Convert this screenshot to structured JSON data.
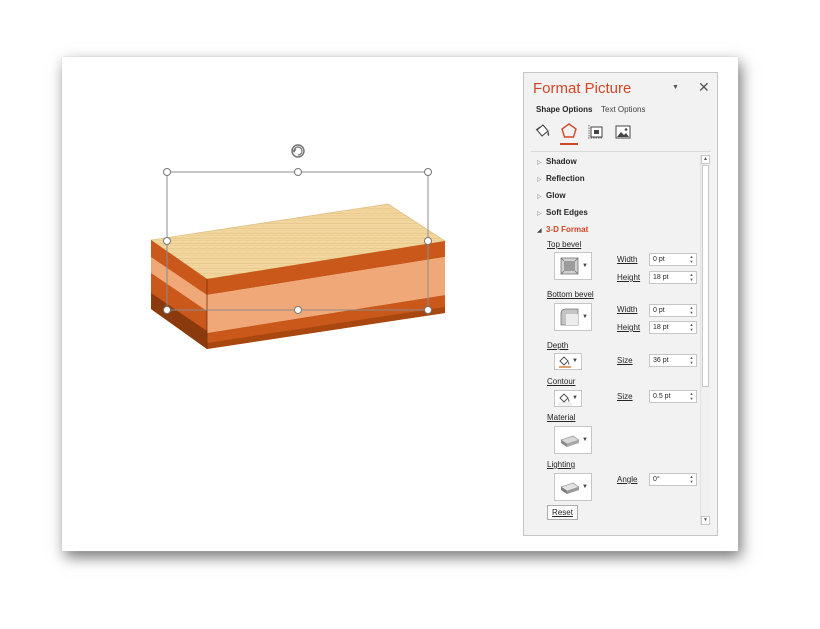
{
  "pane": {
    "title": "Format Picture",
    "pin_icon": "dropdown-triangle-icon",
    "close_icon": "close-icon",
    "close_glyph": "✕",
    "tabs": {
      "shape": "Shape Options",
      "text": "Text Options"
    },
    "icons": [
      "fill-line-icon",
      "effects-pentagon-icon",
      "size-properties-icon",
      "picture-icon"
    ],
    "sections": {
      "shadow": "Shadow",
      "reflection": "Reflection",
      "glow": "Glow",
      "soft_edges": "Soft Edges",
      "three_d": "3-D Format"
    },
    "three_d": {
      "top_bevel": {
        "label": "Top bevel",
        "width_label": "Width",
        "width": "0 pt",
        "height_label": "Height",
        "height": "18 pt"
      },
      "bottom_bevel": {
        "label": "Bottom bevel",
        "width_label": "Width",
        "width": "0 pt",
        "height_label": "Height",
        "height": "18 pt"
      },
      "depth": {
        "label": "Depth",
        "size_label": "Size",
        "size": "36 pt"
      },
      "contour": {
        "label": "Contour",
        "size_label": "Size",
        "size": "0.5 pt"
      },
      "material": {
        "label": "Material"
      },
      "lighting": {
        "label": "Lighting",
        "angle_label": "Angle",
        "angle": "0°"
      },
      "reset": "Reset"
    }
  },
  "colors": {
    "accent": "#d24726",
    "block_orange": "#c9581a",
    "block_dark": "#8a3a0d",
    "block_light": "#f0a878",
    "wood_top": "#f3d79e",
    "selection": "#8c8c8c"
  },
  "canvas": {
    "object": "3d-wood-block",
    "rotate_handle_icon": "rotate-handle-icon"
  }
}
